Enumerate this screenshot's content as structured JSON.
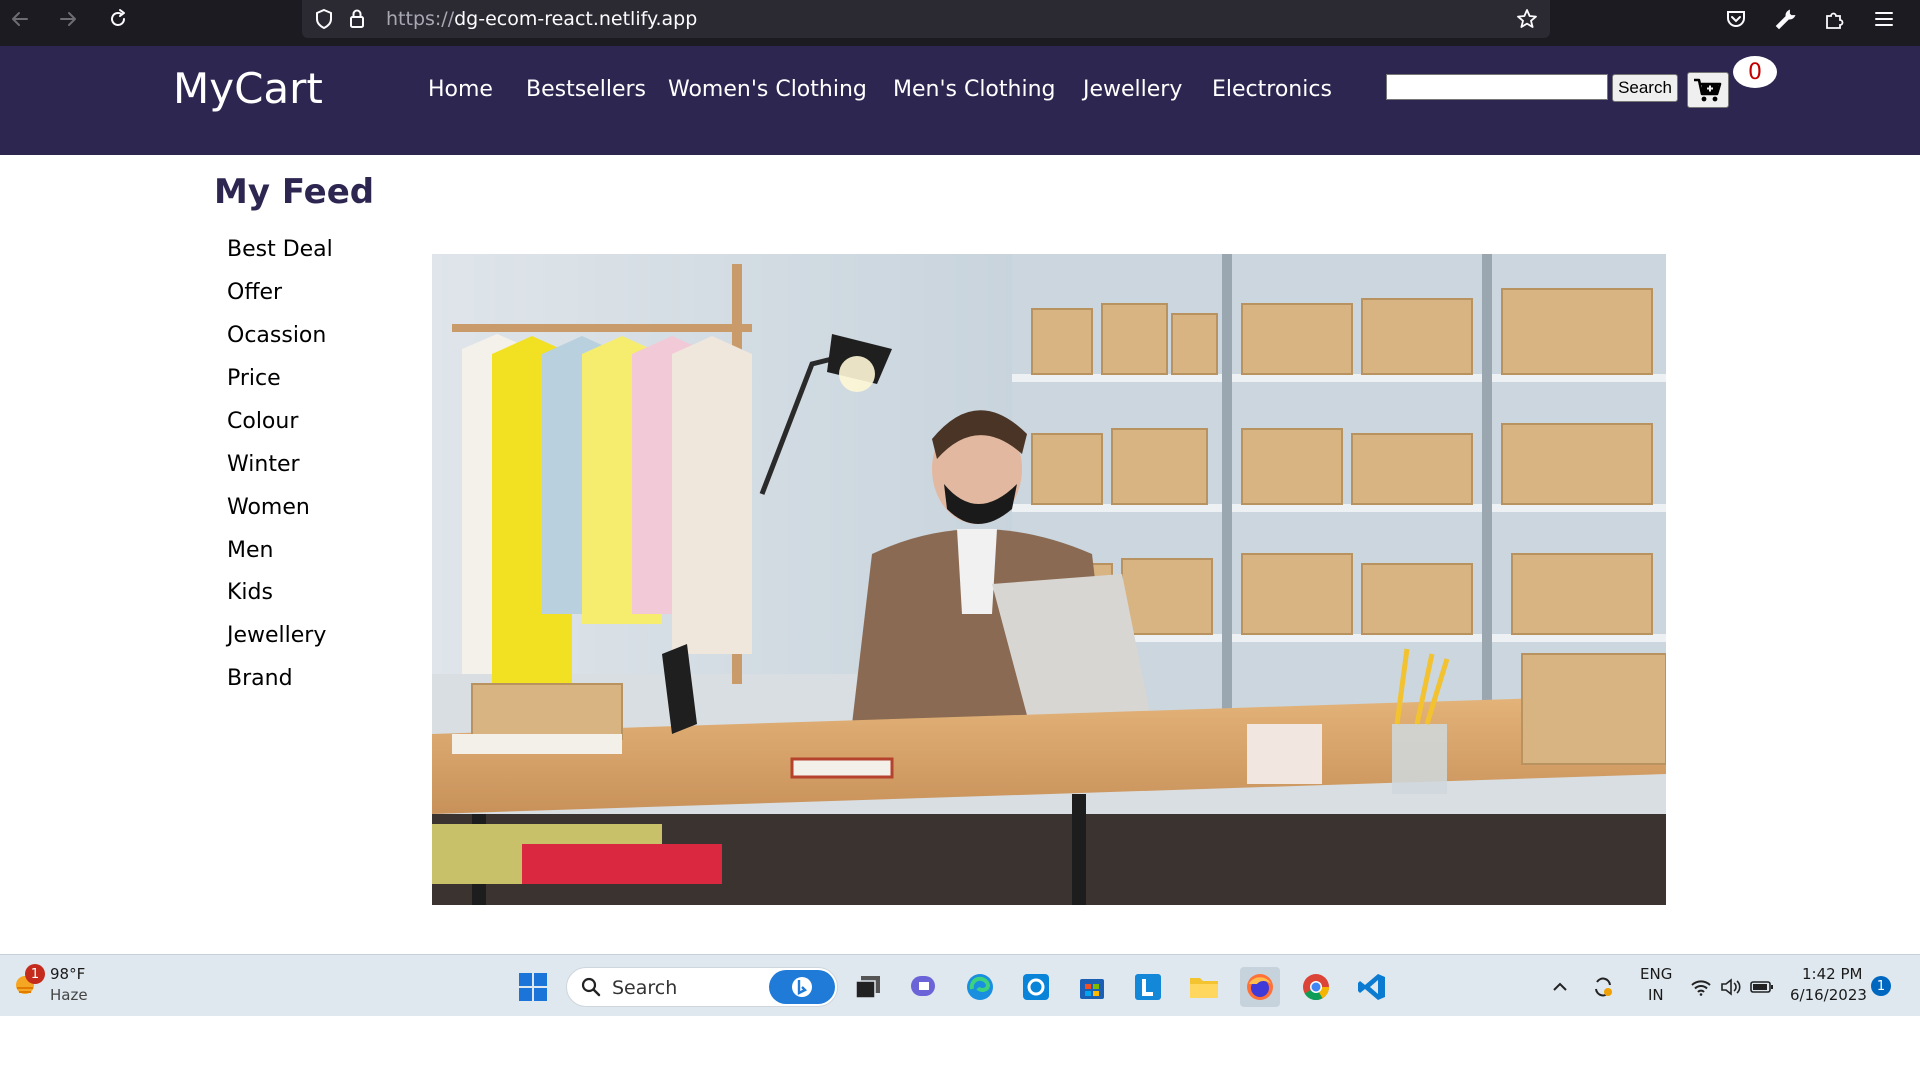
{
  "browser": {
    "url_scheme": "https://",
    "url_host": "dg-ecom-react.netlify.app"
  },
  "header": {
    "logo": "MyCart",
    "nav": [
      "Home",
      "Bestsellers",
      "Women's Clothing",
      "Men's Clothing",
      "Jewellery",
      "Electronics"
    ],
    "search_value": "",
    "search_button": "Search",
    "cart_count": "0"
  },
  "feed": {
    "title": "My Feed",
    "items": [
      "Best Deal",
      "Offer",
      "Ocassion",
      "Price",
      "Colour",
      "Winter",
      "Women",
      "Men",
      "Kids",
      "Jewellery",
      "Brand"
    ]
  },
  "taskbar": {
    "weather_temp": "98°F",
    "weather_desc": "Haze",
    "weather_badge": "1",
    "search_label": "Search",
    "lang_top": "ENG",
    "lang_bottom": "IN",
    "time": "1:42 PM",
    "date": "6/16/2023",
    "notification_count": "1"
  },
  "colors": {
    "header_bg": "#2d2650",
    "browser_bg": "#1c1b22",
    "taskbar_bg": "#dfe8ef",
    "badge_text": "#c00000"
  }
}
